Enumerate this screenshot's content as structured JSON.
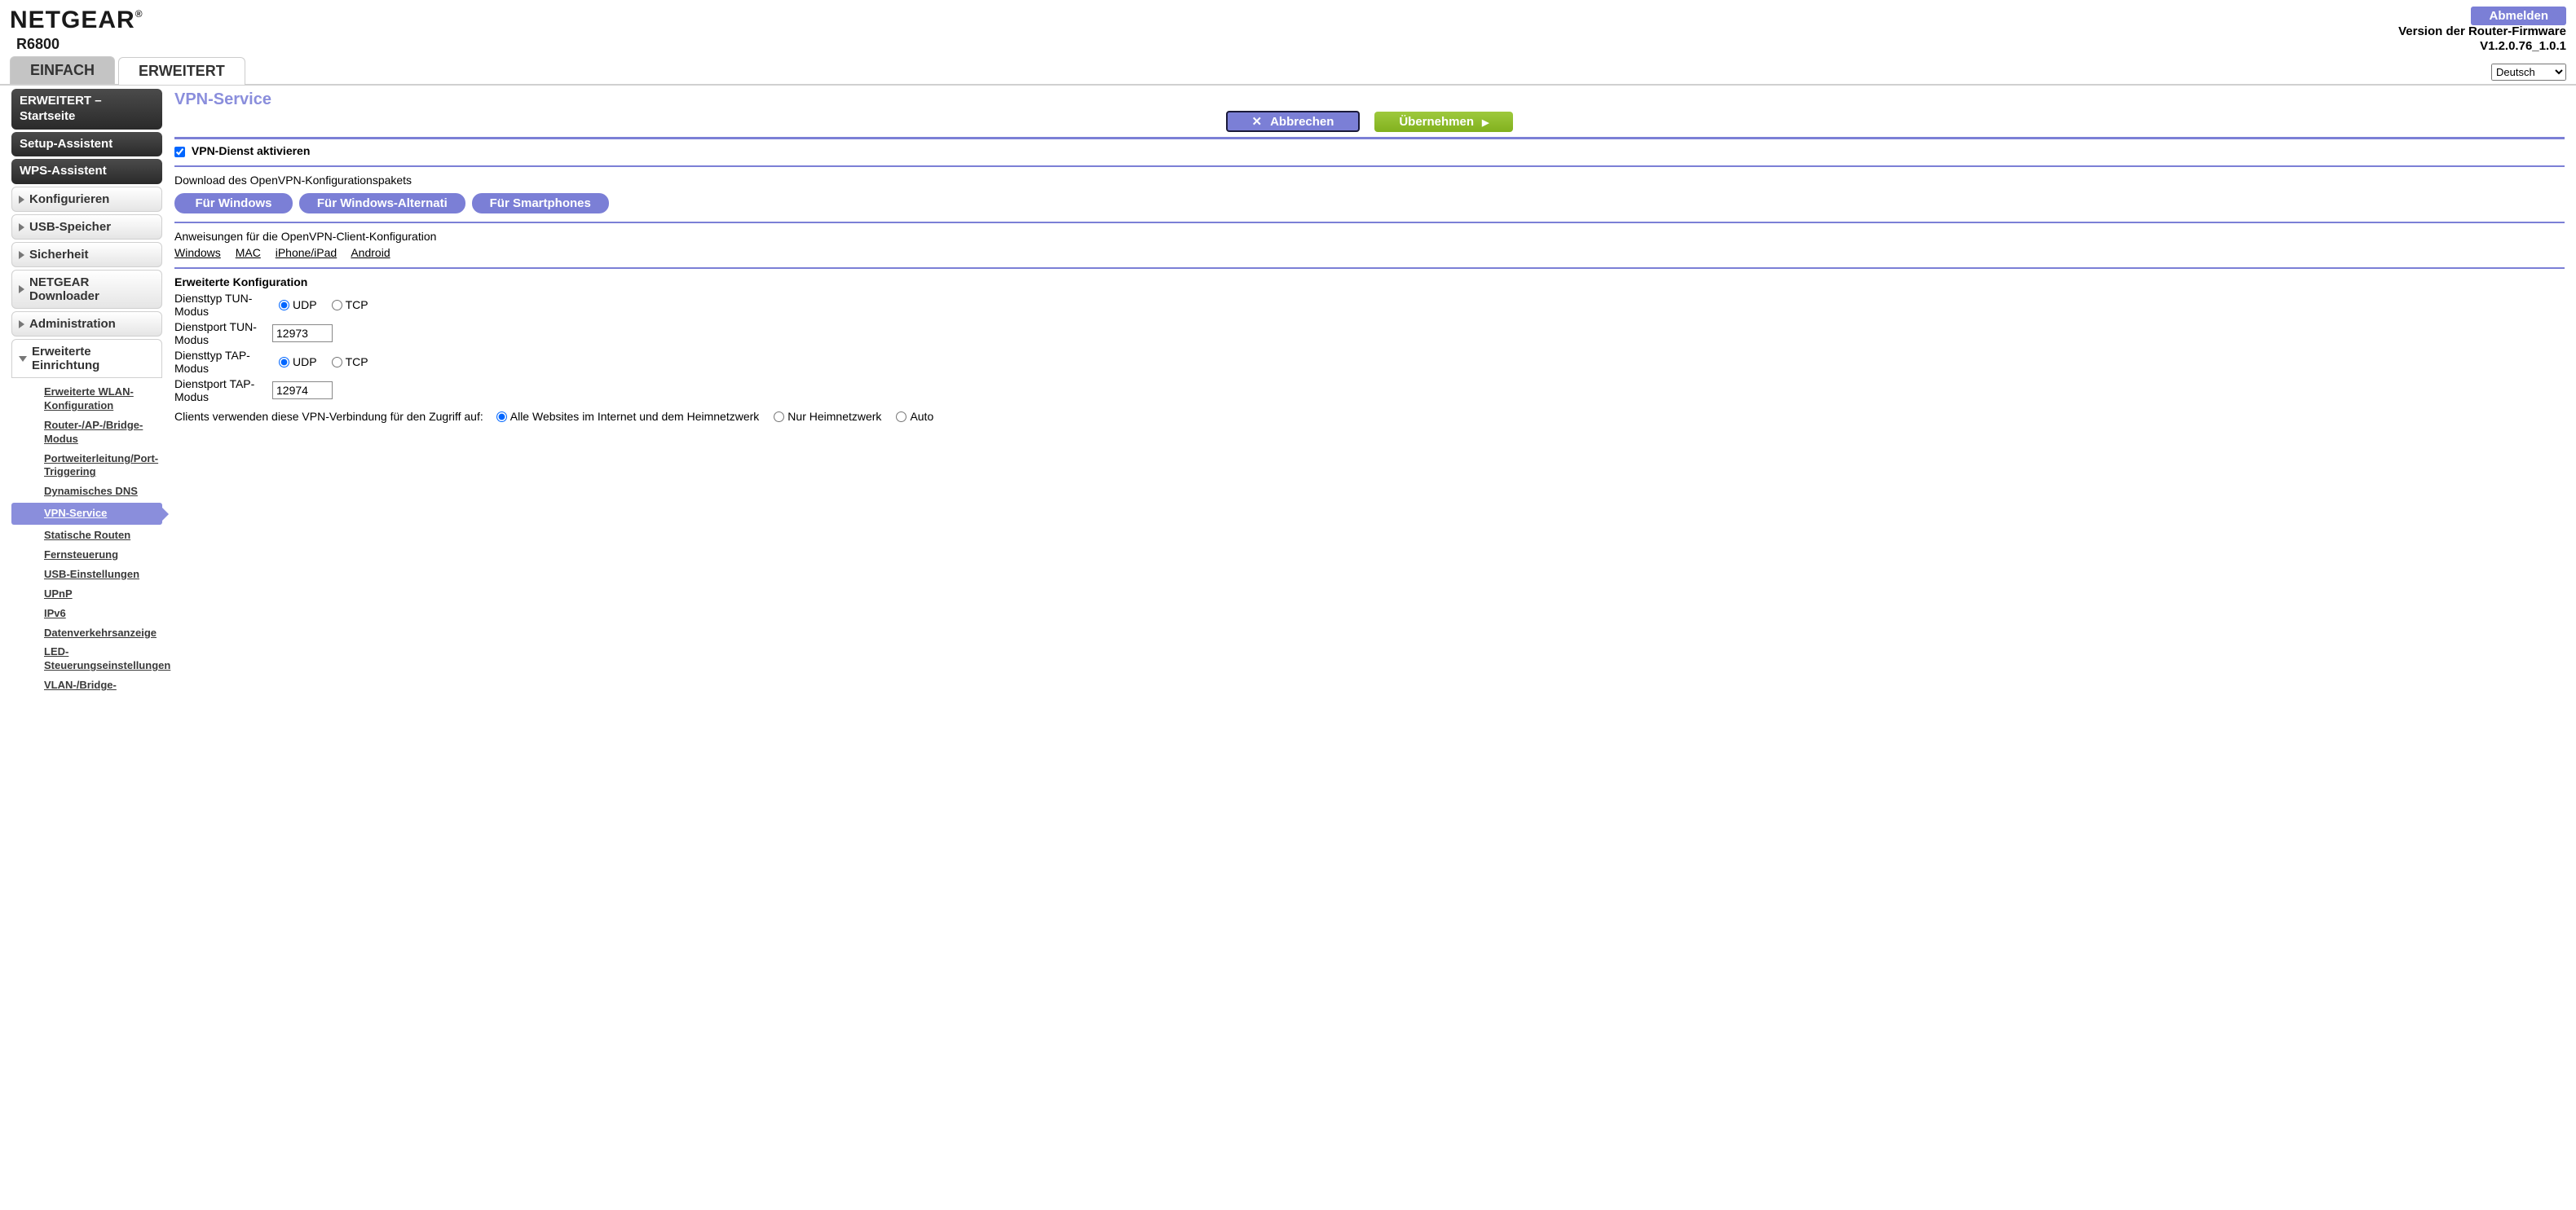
{
  "brand": "NETGEAR",
  "model": "R6800",
  "logout_label": "Abmelden",
  "firmware_label": "Version der Router-Firmware",
  "firmware_version": "V1.2.0.76_1.0.1",
  "tabs": {
    "basic": "EINFACH",
    "advanced": "ERWEITERT"
  },
  "language_selected": "Deutsch",
  "sidebar": {
    "home": "ERWEITERT – Startseite",
    "setup_wizard": "Setup-Assistent",
    "wps_wizard": "WPS-Assistent",
    "configure": "Konfigurieren",
    "usb": "USB-Speicher",
    "security": "Sicherheit",
    "downloader": "NETGEAR Downloader",
    "administration": "Administration",
    "advanced_setup": "Erweiterte Einrichtung",
    "sub": {
      "wlan": "Erweiterte WLAN-Konfiguration",
      "router_mode": "Router-/AP-/Bridge-Modus",
      "port_forward": "Portweiterleitung/Port-Triggering",
      "ddns": "Dynamisches DNS",
      "vpn": "VPN-Service",
      "static_routes": "Statische Routen",
      "remote": "Fernsteuerung",
      "usb_settings": "USB-Einstellungen",
      "upnp": "UPnP",
      "ipv6": "IPv6",
      "traffic": "Datenverkehrsanzeige",
      "led": "LED-Steuerungseinstellungen",
      "vlan": "VLAN-/Bridge-"
    }
  },
  "page": {
    "title": "VPN-Service",
    "cancel": "Abbrechen",
    "apply": "Übernehmen",
    "enable_vpn": "VPN-Dienst aktivieren",
    "download_label": "Download des OpenVPN-Konfigurationspakets",
    "dl_windows": "Für Windows",
    "dl_windows_alt": "Für Windows-Alternati",
    "dl_smartphones": "Für Smartphones",
    "instructions_label": "Anweisungen für die OpenVPN-Client-Konfiguration",
    "link_windows": "Windows",
    "link_mac": "MAC",
    "link_iphone": "iPhone/iPad",
    "link_android": "Android",
    "adv_config": "Erweiterte Konfiguration",
    "tun_type_label": "Diensttyp TUN-Modus",
    "tun_port_label": "Dienstport TUN-Modus",
    "tun_port_value": "12973",
    "tap_type_label": "Diensttyp TAP-Modus",
    "tap_port_label": "Dienstport TAP-Modus",
    "tap_port_value": "12974",
    "udp": "UDP",
    "tcp": "TCP",
    "access_label": "Clients verwenden diese VPN-Verbindung für den Zugriff auf:",
    "access_all": "Alle Websites im Internet und dem Heimnetzwerk",
    "access_home": "Nur Heimnetzwerk",
    "access_auto": "Auto"
  }
}
